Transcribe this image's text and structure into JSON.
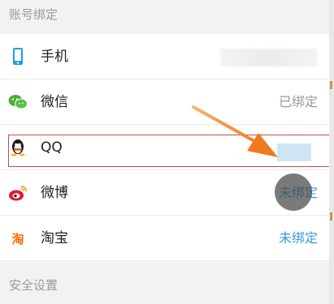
{
  "sections": {
    "account_binding": "账号绑定",
    "security_settings": "安全设置"
  },
  "rows": [
    {
      "name": "手机",
      "status": "",
      "icon": "phone-icon"
    },
    {
      "name": "微信",
      "status": "已绑定",
      "icon": "wechat-icon"
    },
    {
      "name": "QQ",
      "status": "",
      "icon": "qq-icon"
    },
    {
      "name": "微博",
      "status": "未绑定",
      "icon": "weibo-icon"
    },
    {
      "name": "淘宝",
      "status": "未绑定",
      "icon": "taobao-icon"
    }
  ],
  "colors": {
    "unbound": "#3a9bd5",
    "bound": "#9a9a9a",
    "highlight": "#c84a4a",
    "arrow": "#f0822a"
  }
}
